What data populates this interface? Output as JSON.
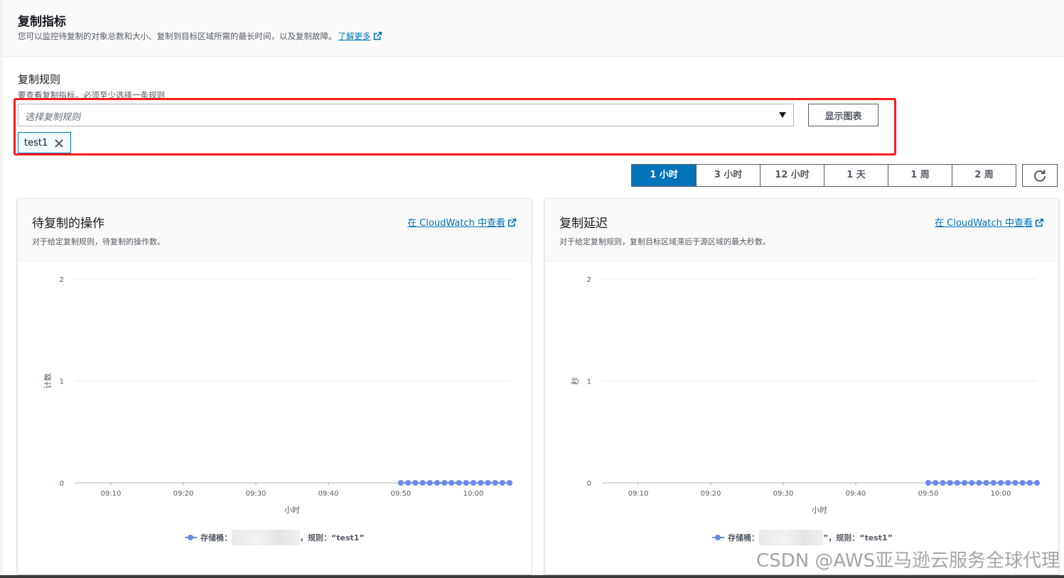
{
  "header": {
    "title": "复制指标",
    "description": "您可以监控待复制的对象总数和大小、复制到目标区域所需的最长时间，以及复制故障。",
    "learn_more": "了解更多"
  },
  "rules": {
    "label": "复制规则",
    "hint": "要查看复制指标，必须至少选择一条规则",
    "placeholder": "选择复制规则",
    "show_chart_button": "显示图表",
    "selected_token": "test1"
  },
  "time_range": {
    "options": [
      "1 小时",
      "3 小时",
      "12 小时",
      "1 天",
      "1 周",
      "2 周"
    ],
    "selected": "1 小时"
  },
  "icons": {
    "external": "external-link-icon",
    "refresh": "refresh-icon",
    "close": "close-icon",
    "caret": "caret-down-icon"
  },
  "colors": {
    "accent": "#0073bb",
    "highlight": "#ff1a1a",
    "series": "#688ae8"
  },
  "panels": [
    {
      "title": "待复制的操作",
      "description": "对于给定复制规则，待复制的操作数。",
      "link": "在 CloudWatch 中查看",
      "legend_prefix": "存储桶：",
      "legend_suffix": "，规则：“test1”"
    },
    {
      "title": "复制延迟",
      "description": "对于给定复制规则，复制目标区域滞后于源区域的最大秒数。",
      "link": "在 CloudWatch 中查看",
      "legend_prefix": "存储桶：",
      "legend_suffix": "”，规则：“test1”"
    }
  ],
  "chart_data": [
    {
      "type": "line",
      "xlabel": "小时",
      "ylabel": "计数",
      "x_ticks": [
        "09:10",
        "09:20",
        "09:30",
        "09:40",
        "09:50",
        "10:00"
      ],
      "y_ticks": [
        0,
        1,
        2
      ],
      "ylim": [
        0,
        2
      ],
      "xlim": [
        "09:05",
        "10:05"
      ],
      "series": [
        {
          "x": [
            "09:50",
            "09:51",
            "09:52",
            "09:53",
            "09:54",
            "09:55",
            "09:56",
            "09:57",
            "09:58",
            "09:59",
            "10:00",
            "10:01",
            "10:02",
            "10:03",
            "10:04",
            "10:05"
          ],
          "values": [
            0,
            0,
            0,
            0,
            0,
            0,
            0,
            0,
            0,
            0,
            0,
            0,
            0,
            0,
            0,
            0
          ]
        }
      ]
    },
    {
      "type": "line",
      "xlabel": "小时",
      "ylabel": "秒",
      "x_ticks": [
        "09:10",
        "09:20",
        "09:30",
        "09:40",
        "09:50",
        "10:00"
      ],
      "y_ticks": [
        0,
        1,
        2
      ],
      "ylim": [
        0,
        2
      ],
      "xlim": [
        "09:05",
        "10:05"
      ],
      "series": [
        {
          "x": [
            "09:50",
            "09:51",
            "09:52",
            "09:53",
            "09:54",
            "09:55",
            "09:56",
            "09:57",
            "09:58",
            "09:59",
            "10:00",
            "10:01",
            "10:02",
            "10:03",
            "10:04",
            "10:05"
          ],
          "values": [
            0,
            0,
            0,
            0,
            0,
            0,
            0,
            0,
            0,
            0,
            0,
            0,
            0,
            0,
            0,
            0
          ]
        }
      ]
    }
  ],
  "watermark": "CSDN @AWS亚马逊云服务全球代理"
}
